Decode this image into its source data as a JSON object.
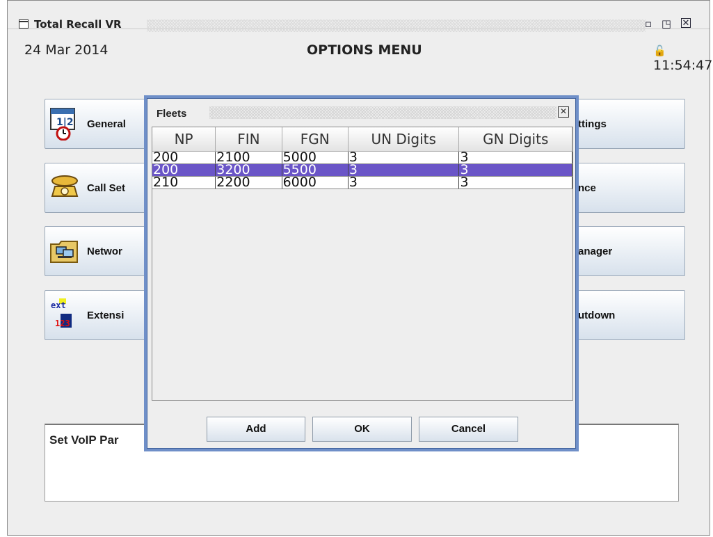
{
  "window": {
    "title": "Total Recall VR"
  },
  "header": {
    "date": "24 Mar 2014",
    "title": "OPTIONS MENU",
    "time": "11:54:47"
  },
  "menu_left": [
    {
      "label": "General",
      "icon": "calendar-clock-icon"
    },
    {
      "label": "Call Set",
      "icon": "telephone-icon"
    },
    {
      "label": "Networ",
      "icon": "network-computer-icon"
    },
    {
      "label": "Extensi",
      "icon": "extension-icon"
    }
  ],
  "menu_right": [
    {
      "label": "ttings"
    },
    {
      "label": "nce"
    },
    {
      "label": "anager"
    },
    {
      "label": "utdown"
    }
  ],
  "extension_icon_text": {
    "top": "ext",
    "bottom": "123"
  },
  "status": {
    "text": "Set VoIP Par"
  },
  "dialog": {
    "title": "Fleets",
    "columns": [
      "NP",
      "FIN",
      "FGN",
      "UN Digits",
      "GN Digits"
    ],
    "rows": [
      [
        "200",
        "2100",
        "5000",
        "3",
        "3"
      ],
      [
        "200",
        "3200",
        "5500",
        "3",
        "3"
      ],
      [
        "210",
        "2200",
        "6000",
        "3",
        "3"
      ]
    ],
    "selected_row": 1,
    "buttons": {
      "add": "Add",
      "ok": "OK",
      "cancel": "Cancel"
    }
  },
  "colors": {
    "selection": "#6a55c7",
    "dialog_border": "#6f8fc8"
  }
}
